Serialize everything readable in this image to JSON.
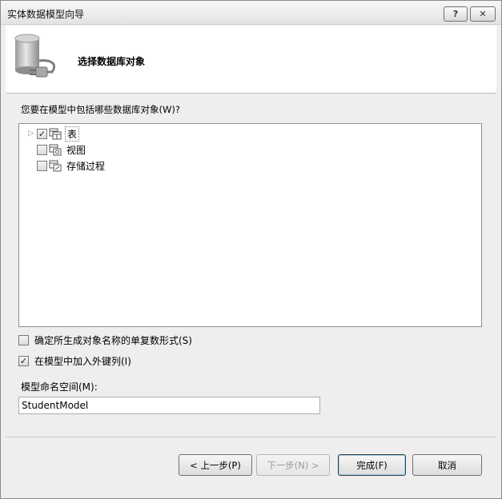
{
  "window": {
    "title": "实体数据模型向导"
  },
  "titlebar": {
    "help_label": "?",
    "close_label": "✕"
  },
  "header": {
    "title": "选择数据库对象"
  },
  "objects": {
    "question": "您要在模型中包括哪些数据库对象(W)?",
    "items": [
      {
        "label": "表",
        "checked": true,
        "check_glyph": "✓",
        "icon": "table-icon"
      },
      {
        "label": "视图",
        "checked": false,
        "check_glyph": "",
        "icon": "view-icon"
      },
      {
        "label": "存储过程",
        "checked": false,
        "check_glyph": "",
        "icon": "stored-procedure-icon"
      }
    ]
  },
  "options": {
    "pluralize": {
      "label": "确定所生成对象名称的单复数形式(S)",
      "checked": false,
      "check_glyph": ""
    },
    "foreign_keys": {
      "label": "在模型中加入外键列(I)",
      "checked": true,
      "check_glyph": "✓"
    }
  },
  "namespace": {
    "label": "模型命名空间(M):",
    "value": "StudentModel"
  },
  "buttons": {
    "prev": "< 上一步(P)",
    "next": "下一步(N) >",
    "finish": "完成(F)",
    "cancel": "取消"
  }
}
